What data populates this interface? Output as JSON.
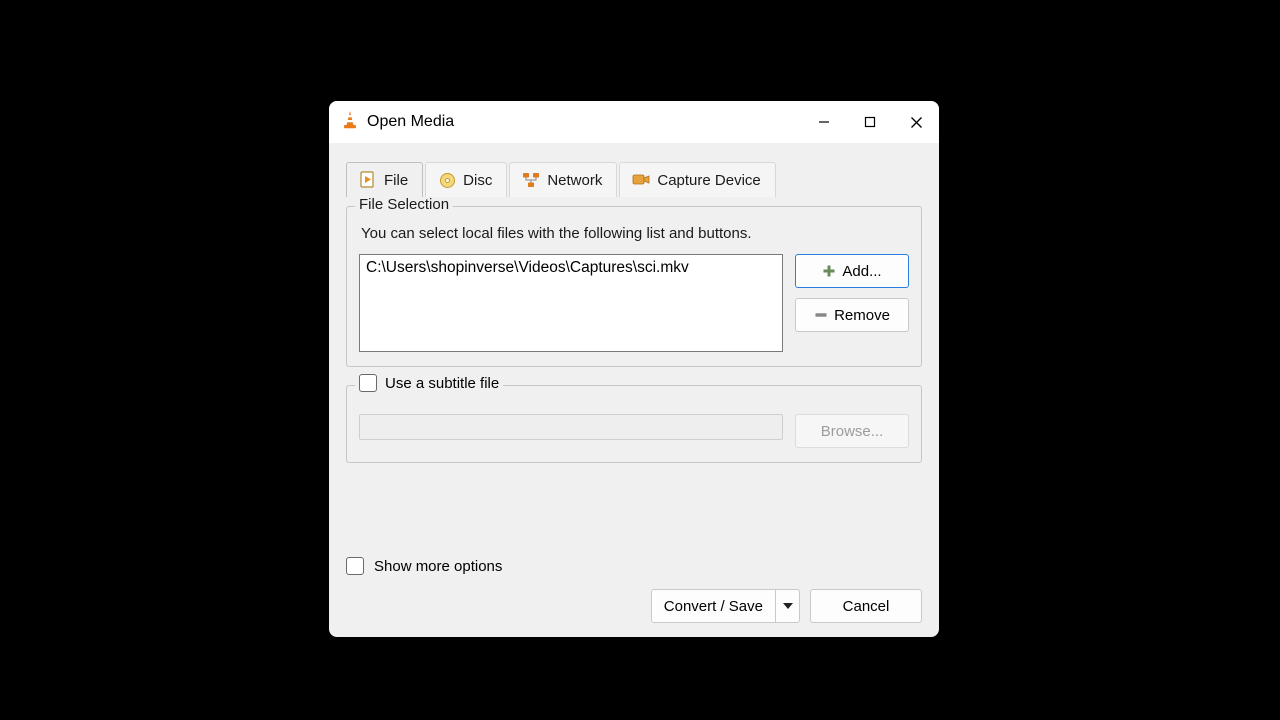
{
  "titlebar": {
    "title": "Open Media"
  },
  "tabs": {
    "file": "File",
    "disc": "Disc",
    "network": "Network",
    "capture": "Capture Device"
  },
  "file_selection": {
    "group_label": "File Selection",
    "hint": "You can select local files with the following list and buttons.",
    "items": [
      "C:\\Users\\shopinverse\\Videos\\Captures\\sci.mkv"
    ],
    "add_label": "Add...",
    "remove_label": "Remove"
  },
  "subtitle": {
    "checkbox_label": "Use a subtitle file",
    "browse_label": "Browse..."
  },
  "footer": {
    "more_options_label": "Show more options",
    "convert_label": "Convert / Save",
    "cancel_label": "Cancel"
  }
}
